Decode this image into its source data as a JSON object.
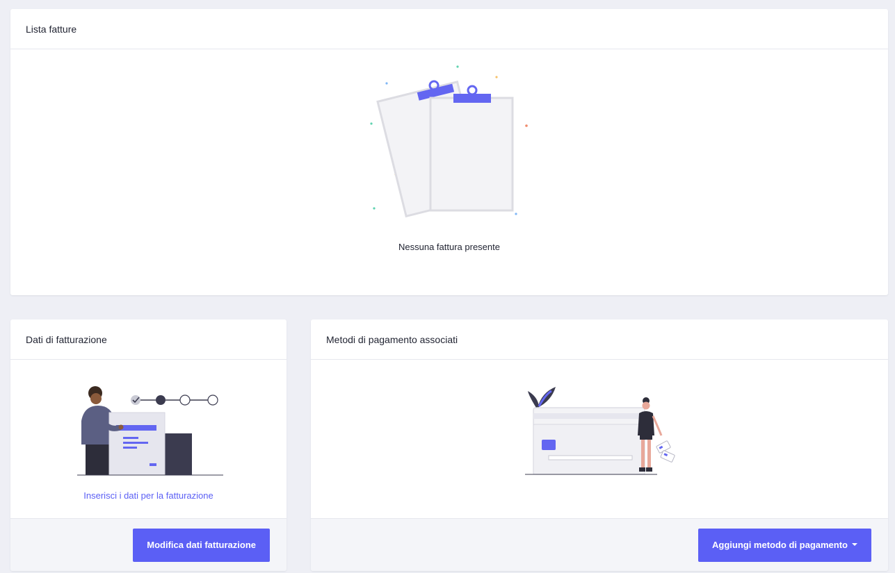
{
  "invoices": {
    "title": "Lista fatture",
    "empty_text": "Nessuna fattura presente"
  },
  "billing": {
    "title": "Dati di fatturazione",
    "link_text": "Inserisci i dati per la fatturazione",
    "button_label": "Modifica dati fatturazione"
  },
  "payments": {
    "title": "Metodi di pagamento associati",
    "button_label": "Aggiungi metodo di pagamento"
  },
  "colors": {
    "accent": "#5b5ff5",
    "background": "#eeeff5",
    "card": "#ffffff",
    "footer": "#f4f5f9"
  },
  "icons": {
    "invoices_illustration": "clipboard-documents-illustration",
    "billing_illustration": "person-form-steps-illustration",
    "payments_illustration": "woman-credit-card-illustration",
    "dropdown": "caret-down-icon"
  }
}
